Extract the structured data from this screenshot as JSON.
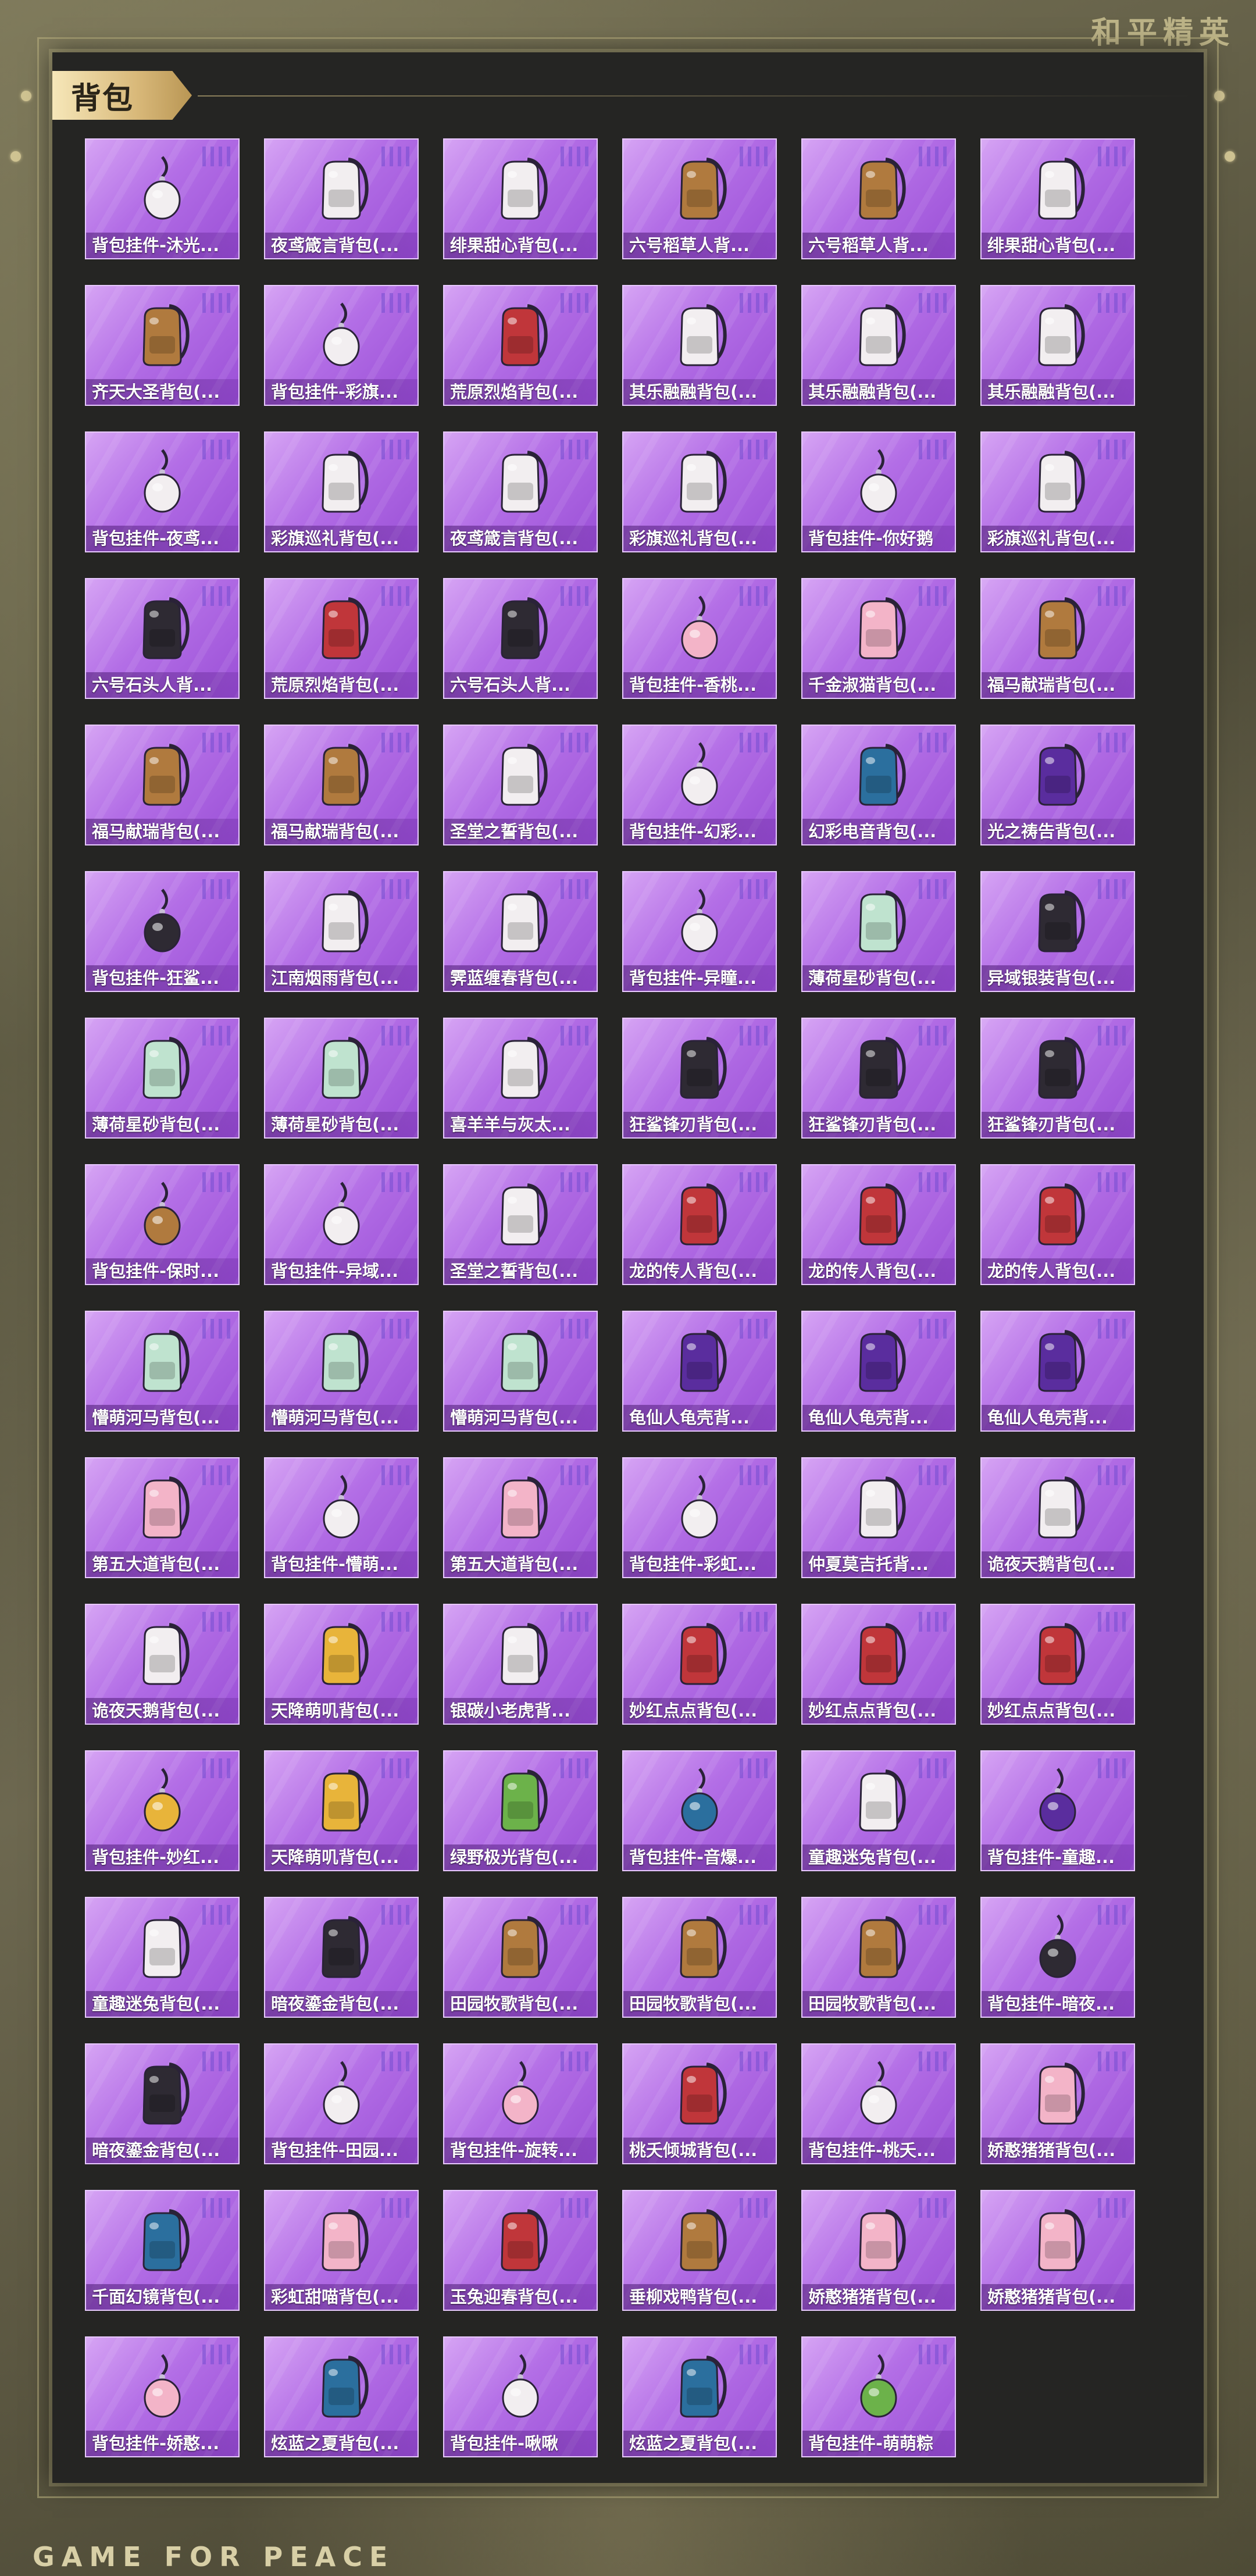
{
  "brand_top": "和平精英",
  "brand_bottom": "GAME FOR PEACE",
  "section_title": "背包",
  "colors": {
    "card_purple": "#b36ee6",
    "panel_bg": "#252523",
    "tag_gold": "#d9b97a"
  },
  "items": [
    {
      "label": "背包挂件-沐光...",
      "icon": "rifle-icon"
    },
    {
      "label": "夜鸢箴言背包(...",
      "icon": "pendant-icon"
    },
    {
      "label": "绯果甜心背包(...",
      "icon": "bunny-backpack-icon"
    },
    {
      "label": "六号稻草人背...",
      "icon": "scarecrow-backpack-icon"
    },
    {
      "label": "六号稻草人背...",
      "icon": "scarecrow-backpack-icon"
    },
    {
      "label": "绯果甜心背包(...",
      "icon": "bunny-backpack-icon"
    },
    {
      "label": "齐天大圣背包(...",
      "icon": "monkey-king-backpack-icon"
    },
    {
      "label": "背包挂件-彩旗...",
      "icon": "icecream-charm-icon"
    },
    {
      "label": "荒原烈焰背包(...",
      "icon": "flame-backpack-icon"
    },
    {
      "label": "其乐融融背包(...",
      "icon": "bunny-backpack-icon"
    },
    {
      "label": "其乐融融背包(...",
      "icon": "bunny-backpack-icon"
    },
    {
      "label": "其乐融融背包(...",
      "icon": "bunny-backpack-icon"
    },
    {
      "label": "背包挂件-夜鸢...",
      "icon": "bird-charm-icon"
    },
    {
      "label": "彩旗巡礼背包(...",
      "icon": "round-backpack-icon"
    },
    {
      "label": "夜鸢箴言背包(...",
      "icon": "pendant-icon"
    },
    {
      "label": "彩旗巡礼背包(...",
      "icon": "round-backpack-icon"
    },
    {
      "label": "背包挂件-你好鹅",
      "icon": "penguin-charm-icon"
    },
    {
      "label": "彩旗巡礼背包(...",
      "icon": "round-backpack-icon"
    },
    {
      "label": "六号石头人背...",
      "icon": "stone-backpack-icon"
    },
    {
      "label": "荒原烈焰背包(...",
      "icon": "flame-backpack-icon"
    },
    {
      "label": "六号石头人背...",
      "icon": "stone-backpack-icon"
    },
    {
      "label": "背包挂件-香桃...",
      "icon": "flower-charm-icon"
    },
    {
      "label": "千金淑猫背包(...",
      "icon": "cat-backpack-icon"
    },
    {
      "label": "福马献瑞背包(...",
      "icon": "horse-backpack-icon"
    },
    {
      "label": "福马献瑞背包(...",
      "icon": "horse-backpack-icon"
    },
    {
      "label": "福马献瑞背包(...",
      "icon": "horse-backpack-icon"
    },
    {
      "label": "圣堂之誓背包(...",
      "icon": "heart-backpack-icon"
    },
    {
      "label": "背包挂件-幻彩...",
      "icon": "robot-charm-icon"
    },
    {
      "label": "幻彩电音背包(...",
      "icon": "speaker-backpack-icon"
    },
    {
      "label": "光之祷告背包(...",
      "icon": "crescent-backpack-icon"
    },
    {
      "label": "背包挂件-狂鲨...",
      "icon": "shark-tooth-charm-icon"
    },
    {
      "label": "江南烟雨背包(...",
      "icon": "umbrella-backpack-icon"
    },
    {
      "label": "霁蓝缠春背包(...",
      "icon": "porcelain-backpack-icon"
    },
    {
      "label": "背包挂件-异瞳...",
      "icon": "fan-charm-icon"
    },
    {
      "label": "薄荷星砂背包(...",
      "icon": "mint-backpack-icon"
    },
    {
      "label": "异域银装背包(...",
      "icon": "armor-backpack-icon"
    },
    {
      "label": "薄荷星砂背包(...",
      "icon": "mint-backpack-icon"
    },
    {
      "label": "薄荷星砂背包(...",
      "icon": "mint-backpack-icon"
    },
    {
      "label": "喜羊羊与灰太...",
      "icon": "sheep-backpack-icon"
    },
    {
      "label": "狂鲨锋刃背包(...",
      "icon": "shark-backpack-icon"
    },
    {
      "label": "狂鲨锋刃背包(...",
      "icon": "shark-backpack-icon"
    },
    {
      "label": "狂鲨锋刃背包(...",
      "icon": "shark-backpack-icon"
    },
    {
      "label": "背包挂件-保时...",
      "icon": "guitar-charm-icon"
    },
    {
      "label": "背包挂件-异域...",
      "icon": "crown-charm-icon"
    },
    {
      "label": "圣堂之誓背包(...",
      "icon": "heart-backpack-icon"
    },
    {
      "label": "龙的传人背包(...",
      "icon": "red-backpack-icon"
    },
    {
      "label": "龙的传人背包(...",
      "icon": "red-backpack-icon"
    },
    {
      "label": "龙的传人背包(...",
      "icon": "red-backpack-icon"
    },
    {
      "label": "懵萌河马背包(...",
      "icon": "hippo-backpack-icon"
    },
    {
      "label": "懵萌河马背包(...",
      "icon": "hippo-backpack-icon"
    },
    {
      "label": "懵萌河马背包(...",
      "icon": "hippo-backpack-icon"
    },
    {
      "label": "龟仙人龟壳背...",
      "icon": "turtle-shell-backpack-icon"
    },
    {
      "label": "龟仙人龟壳背...",
      "icon": "turtle-shell-backpack-icon"
    },
    {
      "label": "龟仙人龟壳背...",
      "icon": "turtle-shell-backpack-icon"
    },
    {
      "label": "第五大道背包(...",
      "icon": "pink-bag-icon"
    },
    {
      "label": "背包挂件-懵萌...",
      "icon": "keychain-charm-icon"
    },
    {
      "label": "第五大道背包(...",
      "icon": "pink-bag-icon"
    },
    {
      "label": "背包挂件-彩虹...",
      "icon": "shell-charm-icon"
    },
    {
      "label": "仲夏莫吉托背...",
      "icon": "drink-backpack-icon"
    },
    {
      "label": "诡夜天鹅背包(...",
      "icon": "swan-backpack-icon"
    },
    {
      "label": "诡夜天鹅背包(...",
      "icon": "swan-backpack-icon"
    },
    {
      "label": "天降萌叽背包(...",
      "icon": "yellow-backpack-icon"
    },
    {
      "label": "银碳小老虎背...",
      "icon": "tiger-backpack-icon"
    },
    {
      "label": "妙红点点背包(...",
      "icon": "ladybug-backpack-icon"
    },
    {
      "label": "妙红点点背包(...",
      "icon": "ladybug-backpack-icon"
    },
    {
      "label": "妙红点点背包(...",
      "icon": "ladybug-backpack-icon"
    },
    {
      "label": "背包挂件-妙红...",
      "icon": "daisy-charm-icon"
    },
    {
      "label": "天降萌叽背包(...",
      "icon": "yellow-backpack-icon"
    },
    {
      "label": "绿野极光背包(...",
      "icon": "green-backpack-icon"
    },
    {
      "label": "背包挂件-音爆...",
      "icon": "badge-charm-icon"
    },
    {
      "label": "童趣迷兔背包(...",
      "icon": "bunny-backpack-icon"
    },
    {
      "label": "背包挂件-童趣...",
      "icon": "heart-charm-icon"
    },
    {
      "label": "童趣迷兔背包(...",
      "icon": "bunny-backpack-icon"
    },
    {
      "label": "暗夜鎏金背包(...",
      "icon": "dark-backpack-icon"
    },
    {
      "label": "田园牧歌背包(...",
      "icon": "basket-backpack-icon"
    },
    {
      "label": "田园牧歌背包(...",
      "icon": "basket-backpack-icon"
    },
    {
      "label": "田园牧歌背包(...",
      "icon": "basket-backpack-icon"
    },
    {
      "label": "背包挂件-暗夜...",
      "icon": "tassel-charm-icon"
    },
    {
      "label": "暗夜鎏金背包(...",
      "icon": "dark-backpack-icon"
    },
    {
      "label": "背包挂件-田园...",
      "icon": "card-charm-icon"
    },
    {
      "label": "背包挂件-旋转...",
      "icon": "unicorn-charm-icon"
    },
    {
      "label": "桃夭倾城背包(...",
      "icon": "lute-backpack-icon"
    },
    {
      "label": "背包挂件-桃夭...",
      "icon": "hairpin-charm-icon"
    },
    {
      "label": "娇憨猪猪背包(...",
      "icon": "pig-backpack-icon"
    },
    {
      "label": "千面幻镜背包(...",
      "icon": "mirror-backpack-icon"
    },
    {
      "label": "彩虹甜喵背包(...",
      "icon": "cat-backpack-icon"
    },
    {
      "label": "玉兔迎春背包(...",
      "icon": "red-backpack-icon"
    },
    {
      "label": "垂柳戏鸭背包(...",
      "icon": "duck-backpack-icon"
    },
    {
      "label": "娇憨猪猪背包(...",
      "icon": "pig-backpack-icon"
    },
    {
      "label": "娇憨猪猪背包(...",
      "icon": "pig-backpack-icon"
    },
    {
      "label": "背包挂件-娇憨...",
      "icon": "pig-charm-icon"
    },
    {
      "label": "炫蓝之夏背包(...",
      "icon": "blue-backpack-icon"
    },
    {
      "label": "背包挂件-啾啾",
      "icon": "bird-charm-icon"
    },
    {
      "label": "炫蓝之夏背包(...",
      "icon": "blue-backpack-icon"
    },
    {
      "label": "背包挂件-萌萌粽",
      "icon": "zongzi-charm-icon"
    }
  ]
}
